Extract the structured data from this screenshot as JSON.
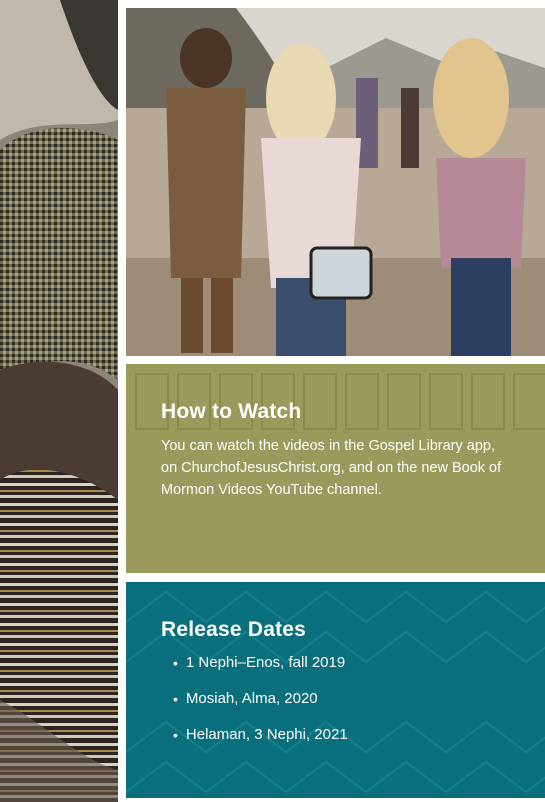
{
  "how_to_watch": {
    "heading": "How to Watch",
    "body": "You can watch the videos in the Gospel Library app, on ChurchofJesusChrist.org, and on the new Book of Mormon Videos YouTube channel."
  },
  "release_dates": {
    "heading": "Release Dates",
    "items": [
      "1 Nephi–Enos, fall 2019",
      "Mosiah, Alma, 2020",
      "Helaman, 3 Nephi, 2021"
    ]
  },
  "colors": {
    "olive_panel": "#9a9a5c",
    "teal_panel": "#0a6f7c",
    "text": "#ffffff"
  }
}
